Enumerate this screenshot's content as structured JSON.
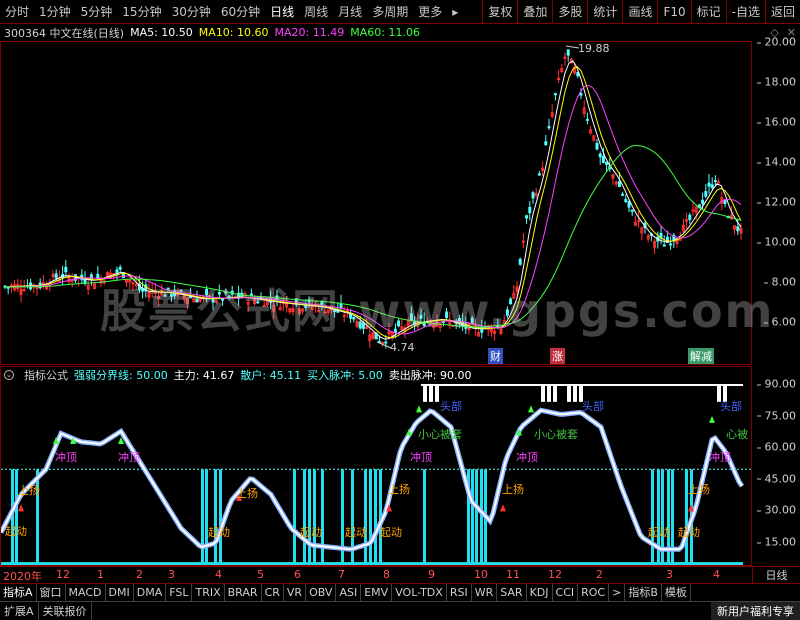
{
  "toolbar": {
    "periods": [
      "分时",
      "1分钟",
      "5分钟",
      "15分钟",
      "30分钟",
      "60分钟",
      "日线",
      "周线",
      "月线",
      "多周期",
      "更多"
    ],
    "active_period": "日线",
    "more_arrow": "▸",
    "buttons": [
      "复权",
      "叠加",
      "多股",
      "统计",
      "画线",
      "F10",
      "标记",
      "-自选",
      "返回"
    ]
  },
  "info": {
    "stock": "300364 中文在线(日线)",
    "ma5": "MA5: 10.50",
    "ma10": "MA10: 10.60",
    "ma20": "MA20: 11.49",
    "ma60": "MA60: 11.06"
  },
  "price_axis": [
    "20.00",
    "18.00",
    "16.00",
    "14.00",
    "12.00",
    "10.00",
    "8.00",
    "6.00"
  ],
  "price_annotations": {
    "high": "19.88",
    "low": "4.74"
  },
  "event_tags": [
    {
      "text": "财",
      "color": "#3050c0"
    },
    {
      "text": "涨",
      "color": "#c03040"
    },
    {
      "text": "解减",
      "color": "#3a9a6a"
    }
  ],
  "watermark": "股票公式网 www.gpgs.com",
  "indicator": {
    "header_label": "指标公式",
    "line_label": "强弱分界线: 50.00",
    "main": "主力: 41.67",
    "retail": "散户: 45.11",
    "buy": "买入脉冲: 5.00",
    "sell": "卖出脉冲: 90.00",
    "axis": [
      "90.00",
      "75.00",
      "60.00",
      "45.00",
      "30.00",
      "15.00"
    ],
    "signals": [
      "起动",
      "上扬",
      "冲顶",
      "小心被套",
      "头部",
      "心被"
    ]
  },
  "dates": {
    "year": "2020年",
    "months": [
      "12",
      "1",
      "2",
      "3",
      "4",
      "5",
      "6",
      "7",
      "8",
      "9",
      "10",
      "11",
      "12",
      "2",
      "3",
      "4"
    ],
    "period": "日线"
  },
  "tabs": [
    "指标A",
    "窗口",
    "MACD",
    "DMI",
    "DMA",
    "FSL",
    "TRIX",
    "BRAR",
    "CR",
    "VR",
    "OBV",
    "ASI",
    "EMV",
    "VOL-TDX",
    "RSI",
    "WR",
    "SAR",
    "KDJ",
    "CCI",
    "ROC",
    ">",
    "指标B",
    "模板"
  ],
  "status": {
    "expand": "扩展A",
    "link": "关联报价",
    "news": "新用户福利专享"
  },
  "colors": {
    "up": "#ff3030",
    "down": "#54ffff",
    "ma5": "#ffffff",
    "ma10": "#ffff00",
    "ma20": "#ff40ff",
    "ma60": "#40ff40",
    "frame": "#800000"
  }
}
